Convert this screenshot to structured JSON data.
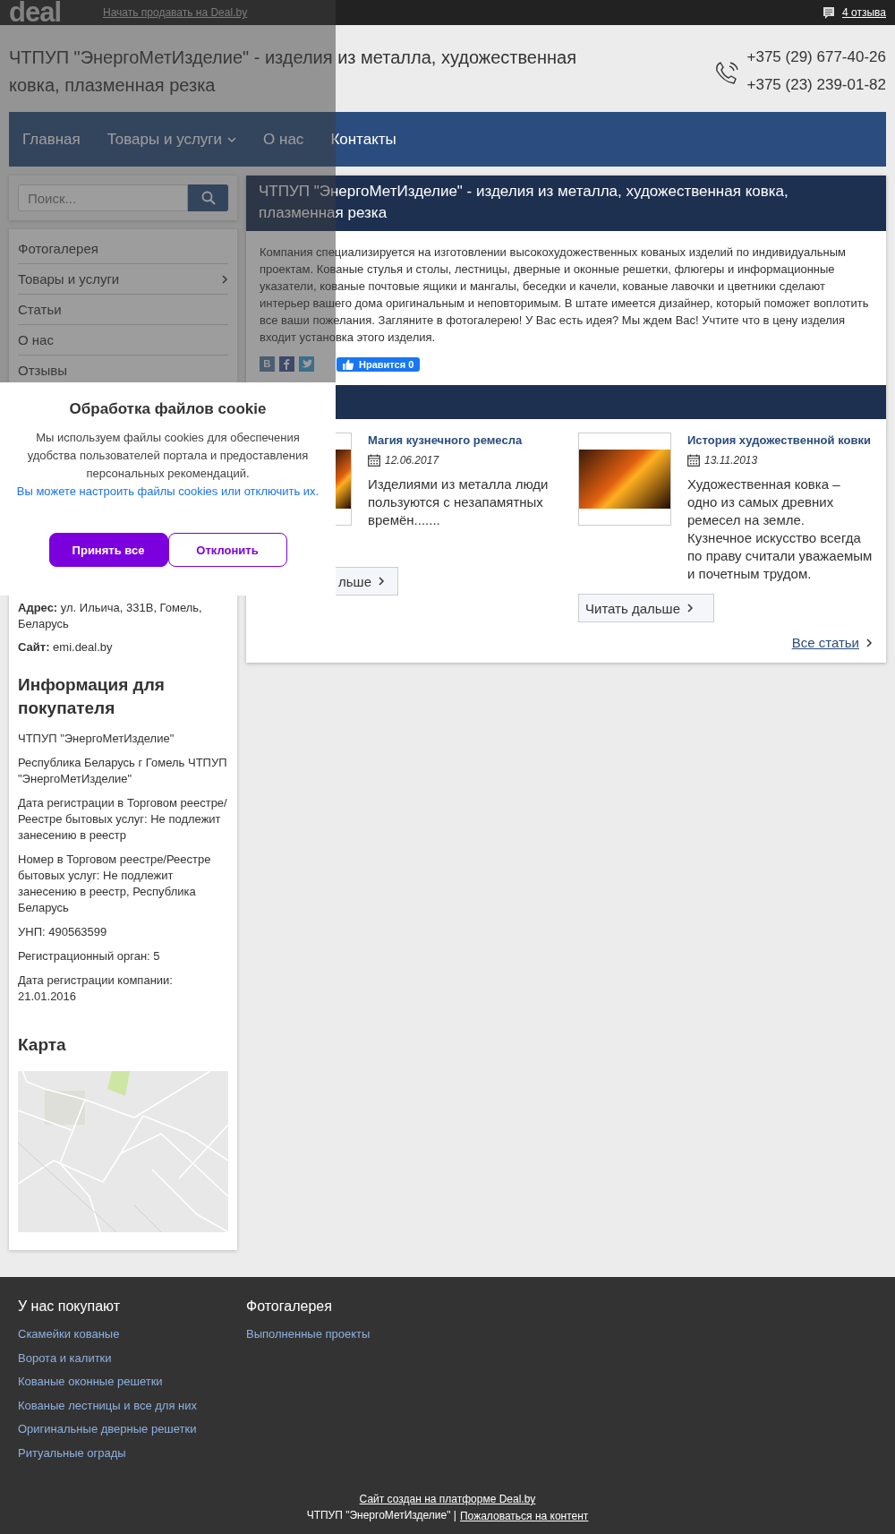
{
  "top_bar": {
    "logo": "deal",
    "sell_link": "Начать продавать на Deal.by",
    "reviews": "4 отзыва"
  },
  "header": {
    "title": "ЧТПУП \"ЭнергоМетИзделие\" - изделия из металла, художественная ковка, плазменная резка",
    "phones": [
      "+375 (29) 677-40-26",
      "+375 (23) 239-01-82"
    ]
  },
  "nav": [
    {
      "label": "Главная",
      "has_submenu": false
    },
    {
      "label": "Товары и услуги",
      "has_submenu": true
    },
    {
      "label": "О нас",
      "has_submenu": false
    },
    {
      "label": "Контакты",
      "has_submenu": false
    }
  ],
  "sidebar": {
    "search": {
      "placeholder": "Поиск..."
    },
    "menu": [
      {
        "label": "Фотогалерея",
        "has_submenu": false
      },
      {
        "label": "Товары и услуги",
        "has_submenu": true
      },
      {
        "label": "Статьи",
        "has_submenu": false
      },
      {
        "label": "О нас",
        "has_submenu": false
      },
      {
        "label": "Отзывы",
        "has_submenu": false
      }
    ],
    "contacts": [
      {
        "label": "Адрес:",
        "value": "ул. Ильича, 331В, Гомель, Беларусь"
      },
      {
        "label": "Сайт:",
        "value": "emi.deal.by"
      }
    ],
    "buyer_info": {
      "title": "Информация для покупателя",
      "lines": [
        "ЧТПУП \"ЭнергоМетИзделие\"",
        "Республика Беларусь г Гомель ЧТПУП \"ЭнергоМетИзделие\"",
        "Дата регистрации в Торговом реестре/Реестре бытовых услуг: Не подлежит занесению в реестр",
        "Номер в Торговом реестре/Реестре бытовых услуг: Не подлежит занесению в реестр, Республика Беларусь",
        "УНП: 490563599",
        "Регистрационный орган: 5",
        "Дата регистрации компании: 21.01.2016"
      ]
    },
    "map": {
      "title": "Карта"
    }
  },
  "main": {
    "title": "ЧТПУП \"ЭнергоМетИзделие\" - изделия из металла, художественная ковка, плазменная резка",
    "description": "Компания специализируется на изготовлении высокохудожественных кованых изделий по индивидуальным проектам. Кованые стулья и столы, лестницы, дверные и оконные решетки, флюгеры и информационные указатели, кованые почтовые ящики и мангалы, беседки и качели, кованые лавочки и цветники сделают интерьер вашего дома оригинальным и неповторимым. В штате имеется дизайнер, который поможет воплотить все ваши пожелания. Загляните в фотогалерею! У Вас есть идея? Мы ждем Вас! Учтите что в цену изделия входит установка этого изделия.",
    "like_button": "Нравится 0",
    "articles": [
      {
        "title": "Магия кузнечного ремесла",
        "date": "12.06.2017",
        "excerpt": "Изделиями из металла люди пользуются с незапамятных времён.......",
        "read_more": "льше"
      },
      {
        "title": "История художественной ковки",
        "date": "13.11.2013",
        "excerpt": "Художественная ковка – одно из самых древних ремесел на земле. Кузнечное искусство всегда по праву считали уважаемым и почетным трудом.",
        "read_more": "Читать дальше"
      }
    ],
    "all_articles": "Все статьи"
  },
  "cookie_dialog": {
    "title": "Обработка файлов cookie",
    "text": "Мы используем файлы cookies для обеспечения удобства пользователей портала и предоставления персональных рекомендаций.",
    "link": "Вы можете настроить файлы cookies или отключить их.",
    "buttons": [
      {
        "label": "Принять все",
        "kind": "primary"
      },
      {
        "label": "Отклонить",
        "kind": "secondary"
      }
    ]
  },
  "footer": {
    "columns": [
      {
        "title": "У нас покупают",
        "links": [
          "Скамейки кованые",
          "Ворота и калитки",
          "Кованые оконные решетки",
          "Кованые лестницы и все для них",
          "Оригинальные дверные решетки",
          "Ритуальные ограды"
        ]
      },
      {
        "title": "Фотогалерея",
        "links": [
          "Выполненные проекты"
        ]
      }
    ],
    "platform_link": "Сайт создан на платформе Deal.by",
    "company": "ЧТПУП \"ЭнергоМетИзделие\" |",
    "complaint_link": "Пожаловаться на контент"
  }
}
